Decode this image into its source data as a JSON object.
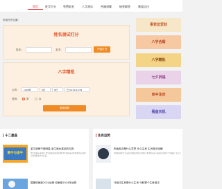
{
  "nav": {
    "items": [
      "首页",
      "姓字打分",
      "免费取名",
      "八字测试",
      "合婚测算",
      "抽签解签",
      "黄道吉日"
    ]
  },
  "breadcrumb": "您现在的位置：",
  "name_test": {
    "title": "姓名测试打分",
    "surname_label": "姓氏：",
    "name_label": "名字：",
    "button": "开始打分"
  },
  "bazi": {
    "title": "八字精批",
    "birth_label": "公历：",
    "year": "1998年",
    "month": "6月",
    "day": "8日",
    "hour": "巳 09:00-10:59",
    "gender_label": "性别：",
    "male": "男",
    "female": "女",
    "button": "免费测算"
  },
  "banners": [
    {
      "text": "事若您爱财",
      "bg": "#f7e7c9",
      "fg": "#c05b2c"
    },
    {
      "text": "八字合婚",
      "bg": "#f7c9a3",
      "fg": "#b3401f"
    },
    {
      "text": "八字精批",
      "bg": "#f4d486",
      "fg": "#8b4a17"
    },
    {
      "text": "七夕祈福",
      "bg": "#ead3e8",
      "fg": "#8a3f86"
    },
    {
      "text": "命中注定",
      "bg": "#f4c89a",
      "fg": "#b8461a"
    },
    {
      "text": "看盘天机",
      "bg": "#d9d6f4",
      "fg": "#4d44a8"
    }
  ],
  "left_panel": {
    "title": "十二星座",
    "articles": [
      {
        "title": "金牛座狮子座明星 金牛座女喜欢的礼物",
        "desc": "金牛座狮子座明星 金牛座女喜欢的礼物 金牛座向来以稳重和务实著称 对待感情也十分认真",
        "thumb_text": "狮子与金牛"
      },
      {
        "title": "属猪双鱼座2024运势 双鱼座2024年运势",
        "desc": "",
        "thumb_text": ""
      }
    ]
  },
  "right_panel": {
    "title": "生肖运势",
    "articles": [
      {
        "title": "狗兔相冲是什么意思 什么生肖 生肖相冲化解",
        "desc": "狗兔相冲是什么意思 狗和兔在生肖中属于相冲的关系 这是因为狗属土 兔属木 木克土"
      },
      {
        "title": "马相冲生肖是什么生肖 马和哪个生肖相冲",
        "desc": ""
      }
    ]
  }
}
